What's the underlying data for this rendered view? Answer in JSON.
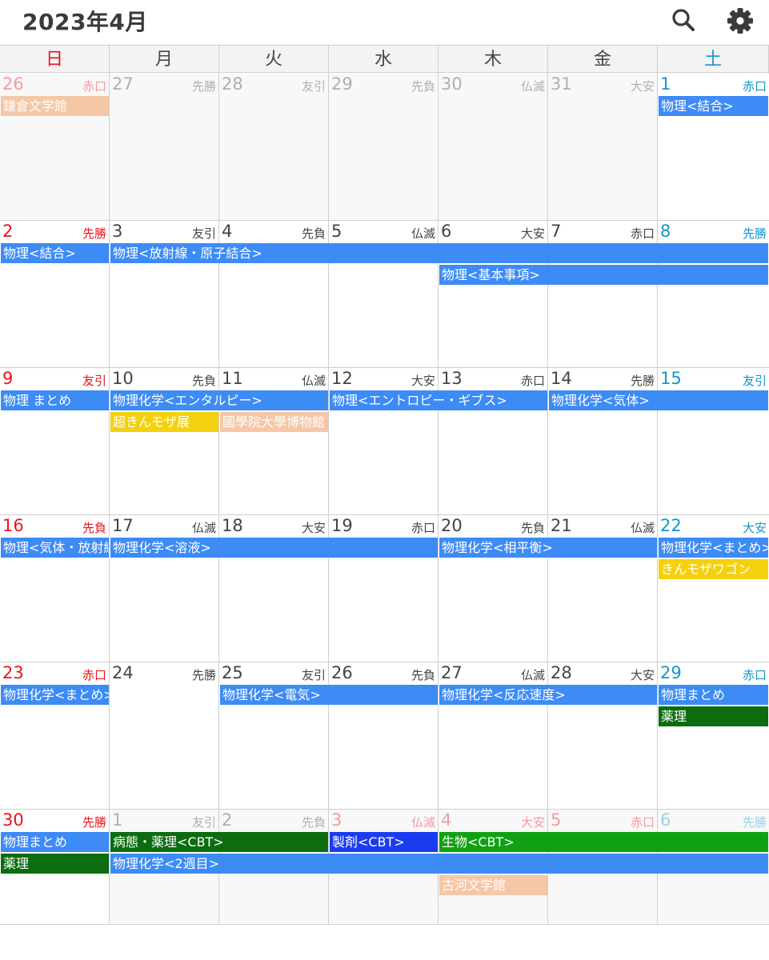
{
  "header": {
    "title": "2023年4月",
    "search_icon": "search-icon",
    "settings_icon": "gear-icon"
  },
  "colors": {
    "sunday": "#e8141c",
    "saturday": "#1596c8",
    "weekday": "#444444",
    "outside_opacity": "0.4",
    "blue": "#3d8bf5",
    "peach": "#f5c7a6",
    "yellow": "#f4d10f",
    "dark_green": "#0b6d10",
    "royal_blue": "#1a3cf0",
    "green": "#10a113"
  },
  "weekdays": [
    {
      "label": "日",
      "type": "sun"
    },
    {
      "label": "月",
      "type": "wd"
    },
    {
      "label": "火",
      "type": "wd"
    },
    {
      "label": "水",
      "type": "wd"
    },
    {
      "label": "木",
      "type": "wd"
    },
    {
      "label": "金",
      "type": "wd"
    },
    {
      "label": "土",
      "type": "sat"
    }
  ],
  "weeks": [
    {
      "days": [
        {
          "d": "26",
          "r": "赤口",
          "out": true
        },
        {
          "d": "27",
          "r": "先勝",
          "out": true
        },
        {
          "d": "28",
          "r": "友引",
          "out": true
        },
        {
          "d": "29",
          "r": "先負",
          "out": true
        },
        {
          "d": "30",
          "r": "仏滅",
          "out": true
        },
        {
          "d": "31",
          "r": "大安",
          "out": true
        },
        {
          "d": "1",
          "r": "赤口",
          "out": false
        }
      ],
      "events": [
        {
          "title": "鎌倉文学館",
          "start": 0,
          "span": 1,
          "row": 0,
          "color": "peach"
        },
        {
          "title": "物理<結合>",
          "start": 6,
          "span": 1,
          "row": 0,
          "color": "blue"
        }
      ]
    },
    {
      "days": [
        {
          "d": "2",
          "r": "先勝",
          "out": false
        },
        {
          "d": "3",
          "r": "友引",
          "out": false
        },
        {
          "d": "4",
          "r": "先負",
          "out": false
        },
        {
          "d": "5",
          "r": "仏滅",
          "out": false
        },
        {
          "d": "6",
          "r": "大安",
          "out": false
        },
        {
          "d": "7",
          "r": "赤口",
          "out": false
        },
        {
          "d": "8",
          "r": "先勝",
          "out": false
        }
      ],
      "events": [
        {
          "title": "物理<結合>",
          "start": 0,
          "span": 1,
          "row": 0,
          "color": "blue"
        },
        {
          "title": "物理<放射線・原子結合>",
          "start": 1,
          "span": 6,
          "row": 0,
          "color": "blue"
        },
        {
          "title": "物理<基本事項>",
          "start": 4,
          "span": 3,
          "row": 1,
          "color": "blue"
        }
      ]
    },
    {
      "days": [
        {
          "d": "9",
          "r": "友引",
          "out": false
        },
        {
          "d": "10",
          "r": "先負",
          "out": false
        },
        {
          "d": "11",
          "r": "仏滅",
          "out": false
        },
        {
          "d": "12",
          "r": "大安",
          "out": false
        },
        {
          "d": "13",
          "r": "赤口",
          "out": false
        },
        {
          "d": "14",
          "r": "先勝",
          "out": false
        },
        {
          "d": "15",
          "r": "友引",
          "out": false
        }
      ],
      "events": [
        {
          "title": "物理 まとめ",
          "start": 0,
          "span": 1,
          "row": 0,
          "color": "blue"
        },
        {
          "title": "物理化学<エンタルピー>",
          "start": 1,
          "span": 2,
          "row": 0,
          "color": "blue"
        },
        {
          "title": "物理<エントロピー・ギブス>",
          "start": 3,
          "span": 2,
          "row": 0,
          "color": "blue"
        },
        {
          "title": "物理化学<気体>",
          "start": 5,
          "span": 2,
          "row": 0,
          "color": "blue"
        },
        {
          "title": "超きんモザ展",
          "start": 1,
          "span": 1,
          "row": 1,
          "color": "yellow"
        },
        {
          "title": "國學院大學博物館",
          "start": 2,
          "span": 1,
          "row": 1,
          "color": "peach"
        }
      ]
    },
    {
      "days": [
        {
          "d": "16",
          "r": "先負",
          "out": false
        },
        {
          "d": "17",
          "r": "仏滅",
          "out": false
        },
        {
          "d": "18",
          "r": "大安",
          "out": false
        },
        {
          "d": "19",
          "r": "赤口",
          "out": false
        },
        {
          "d": "20",
          "r": "先負",
          "out": false
        },
        {
          "d": "21",
          "r": "仏滅",
          "out": false
        },
        {
          "d": "22",
          "r": "大安",
          "out": false
        }
      ],
      "events": [
        {
          "title": "物理<気体・放射線>",
          "start": 0,
          "span": 1,
          "row": 0,
          "color": "blue"
        },
        {
          "title": "物理化学<溶液>",
          "start": 1,
          "span": 3,
          "row": 0,
          "color": "blue"
        },
        {
          "title": "物理化学<相平衡>",
          "start": 4,
          "span": 2,
          "row": 0,
          "color": "blue"
        },
        {
          "title": "物理化学<まとめ>",
          "start": 6,
          "span": 1,
          "row": 0,
          "color": "blue"
        },
        {
          "title": "きんモザワゴン",
          "start": 6,
          "span": 1,
          "row": 1,
          "color": "yellow"
        }
      ]
    },
    {
      "days": [
        {
          "d": "23",
          "r": "赤口",
          "out": false
        },
        {
          "d": "24",
          "r": "先勝",
          "out": false
        },
        {
          "d": "25",
          "r": "友引",
          "out": false
        },
        {
          "d": "26",
          "r": "先負",
          "out": false
        },
        {
          "d": "27",
          "r": "仏滅",
          "out": false
        },
        {
          "d": "28",
          "r": "大安",
          "out": false
        },
        {
          "d": "29",
          "r": "赤口",
          "out": false
        }
      ],
      "events": [
        {
          "title": "物理化学<まとめ>",
          "start": 0,
          "span": 1,
          "row": 0,
          "color": "blue"
        },
        {
          "title": "物理化学<電気>",
          "start": 2,
          "span": 2,
          "row": 0,
          "color": "blue"
        },
        {
          "title": "物理化学<反応速度>",
          "start": 4,
          "span": 2,
          "row": 0,
          "color": "blue"
        },
        {
          "title": "物理まとめ",
          "start": 6,
          "span": 1,
          "row": 0,
          "color": "blue"
        },
        {
          "title": "薬理",
          "start": 6,
          "span": 1,
          "row": 1,
          "color": "dark_green"
        }
      ]
    },
    {
      "days": [
        {
          "d": "30",
          "r": "先勝",
          "out": false
        },
        {
          "d": "1",
          "r": "友引",
          "out": true
        },
        {
          "d": "2",
          "r": "先負",
          "out": true
        },
        {
          "d": "3",
          "r": "仏滅",
          "out": true,
          "holiday": true
        },
        {
          "d": "4",
          "r": "大安",
          "out": true,
          "holiday": true
        },
        {
          "d": "5",
          "r": "赤口",
          "out": true,
          "holiday": true
        },
        {
          "d": "6",
          "r": "先勝",
          "out": true
        }
      ],
      "events": [
        {
          "title": "物理まとめ",
          "start": 0,
          "span": 1,
          "row": 0,
          "color": "blue"
        },
        {
          "title": "病態・薬理<CBT>",
          "start": 1,
          "span": 2,
          "row": 0,
          "color": "dark_green"
        },
        {
          "title": "製剤<CBT>",
          "start": 3,
          "span": 1,
          "row": 0,
          "color": "royal_blue"
        },
        {
          "title": "生物<CBT>",
          "start": 4,
          "span": 3,
          "row": 0,
          "color": "green"
        },
        {
          "title": "薬理",
          "start": 0,
          "span": 1,
          "row": 1,
          "color": "dark_green"
        },
        {
          "title": "物理化学<2週目>",
          "start": 1,
          "span": 6,
          "row": 1,
          "color": "blue"
        },
        {
          "title": "古河文学館",
          "start": 4,
          "span": 1,
          "row": 2,
          "color": "peach"
        }
      ]
    }
  ]
}
